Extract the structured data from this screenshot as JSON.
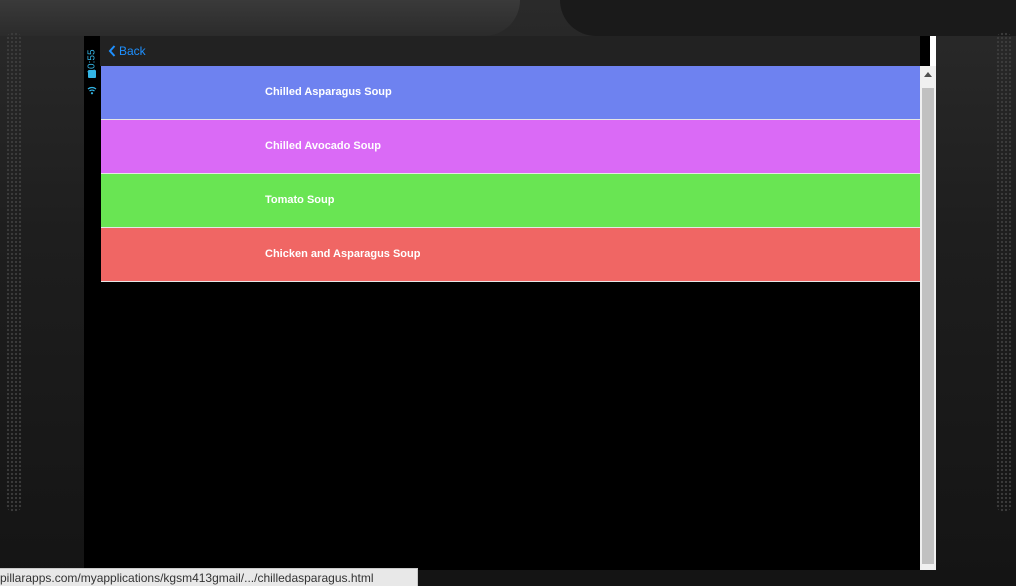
{
  "status_bar": {
    "time": "10:55",
    "battery_icon": "battery-icon",
    "wifi_icon": "wifi-icon",
    "accent_color": "#33b5e5"
  },
  "header": {
    "back_label": "Back",
    "back_icon": "chevron-left-icon"
  },
  "list": {
    "items": [
      {
        "label": "Chilled Asparagus Soup",
        "color": "#6e82f0"
      },
      {
        "label": "Chilled Avocado Soup",
        "color": "#da6af6"
      },
      {
        "label": "Tomato Soup",
        "color": "#69e553"
      },
      {
        "label": "Chicken and Asparagus Soup",
        "color": "#f06664"
      }
    ]
  },
  "browser_status": {
    "url": "pillarapps.com/myapplications/kgsm413gmail/.../chilledasparagus.html"
  }
}
